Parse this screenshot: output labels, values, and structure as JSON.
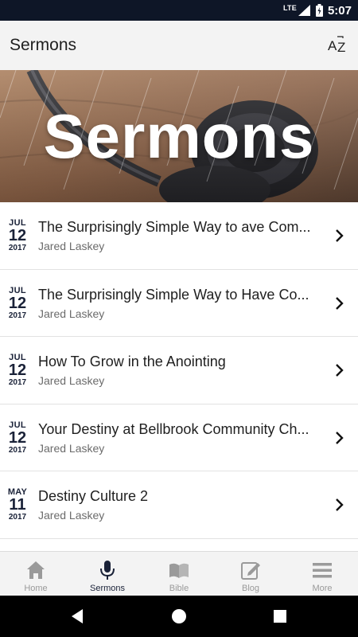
{
  "status_bar": {
    "network": "LTE",
    "time": "5:07"
  },
  "app_bar": {
    "title": "Sermons",
    "sort_icon": "az-sort-icon"
  },
  "banner": {
    "title": "Sermons"
  },
  "sermons": [
    {
      "month": "JUL",
      "day": "12",
      "year": "2017",
      "title": "The Surprisingly Simple Way to ave Com...",
      "speaker": "Jared Laskey"
    },
    {
      "month": "JUL",
      "day": "12",
      "year": "2017",
      "title": "The Surprisingly Simple Way to Have Co...",
      "speaker": "Jared Laskey"
    },
    {
      "month": "JUL",
      "day": "12",
      "year": "2017",
      "title": "How To Grow in the Anointing",
      "speaker": "Jared Laskey"
    },
    {
      "month": "JUL",
      "day": "12",
      "year": "2017",
      "title": "Your Destiny at Bellbrook Community Ch...",
      "speaker": "Jared Laskey"
    },
    {
      "month": "MAY",
      "day": "11",
      "year": "2017",
      "title": "Destiny Culture 2",
      "speaker": "Jared Laskey"
    }
  ],
  "bottom_nav": [
    {
      "label": "Home",
      "icon": "home-icon",
      "active": false
    },
    {
      "label": "Sermons",
      "icon": "microphone-icon",
      "active": true
    },
    {
      "label": "Bible",
      "icon": "book-icon",
      "active": false
    },
    {
      "label": "Blog",
      "icon": "edit-icon",
      "active": false
    },
    {
      "label": "More",
      "icon": "menu-icon",
      "active": false
    }
  ],
  "colors": {
    "accent": "#1a2238",
    "status_bar": "#0e1627",
    "inactive": "#9a9a9a"
  }
}
